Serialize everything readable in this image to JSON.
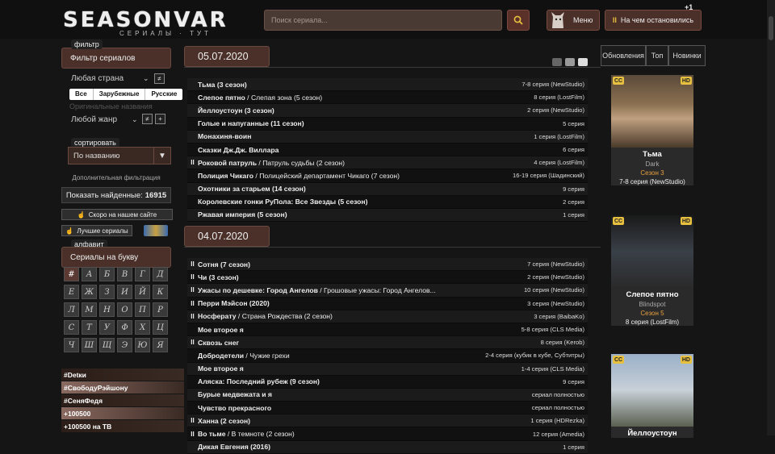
{
  "header": {
    "logo_text": "SEASONVAR",
    "logo_sub": "СЕРИАЛЫ · ТУТ",
    "search_placeholder": "Поиск сериала...",
    "menu_label": "Меню",
    "stop_label": "На чем остановились",
    "plus_badge": "+1"
  },
  "sidebar": {
    "filter_tag": "фильтр",
    "filter_title": "Фильтр сериалов",
    "country_select": "Любая страна",
    "country_buttons": [
      "Все",
      "Зарубежные",
      "Русские"
    ],
    "original_names": "Оригинальные названия",
    "genre_select": "Любой жанр",
    "not_label": "≠",
    "plus_label": "+",
    "sort_tag": "сортировать",
    "sort_value": "По названию",
    "extra_filter": "Дополнительная фильтрация",
    "found_label": "Показать найденные:",
    "found_count": "16915",
    "soon_label": "Скоро на нашем сайте",
    "best_label": "Лучшие сериалы",
    "alpha_tag": "алфавит",
    "alpha_title": "Сериалы на букву",
    "letters": [
      "#",
      "А",
      "Б",
      "В",
      "Г",
      "Д",
      "Е",
      "Ж",
      "З",
      "И",
      "Й",
      "К",
      "Л",
      "М",
      "Н",
      "О",
      "П",
      "Р",
      "С",
      "Т",
      "У",
      "Ф",
      "Х",
      "Ц",
      "Ч",
      "Ш",
      "Щ",
      "Э",
      "Ю",
      "Я"
    ],
    "hashtags": [
      {
        "text": "#Detки",
        "color": "#2b1d17"
      },
      {
        "text": "#СвободуРэйшону",
        "color": "#8a6a60"
      },
      {
        "text": "#СеняФедя",
        "color": "#2b1d17"
      },
      {
        "text": "+100500",
        "color": "#8a6a60"
      },
      {
        "text": "+100500 на ТВ",
        "color": "#2b1d17"
      }
    ]
  },
  "days": [
    {
      "date": "05.07.2020",
      "rows": [
        {
          "pause": false,
          "title": "Тьма (3 сезон)",
          "alt": "",
          "ep": "7-8 серия (NewStudio)"
        },
        {
          "pause": false,
          "title": "Слепое пятно",
          "alt": " / Слепая зона (5 сезон)",
          "ep": "8 серия (LostFilm)"
        },
        {
          "pause": false,
          "title": "Йеллоустоун (3 сезон)",
          "alt": "",
          "ep": "2 серия (NewStudio)"
        },
        {
          "pause": false,
          "title": "Голые и напуганные (11 сезон)",
          "alt": "",
          "ep": "5 серия"
        },
        {
          "pause": false,
          "title": "Монахиня-воин",
          "alt": "",
          "ep": "1 серия (LostFilm)"
        },
        {
          "pause": false,
          "title": "Сказки Дж.Дж. Виллара",
          "alt": "",
          "ep": "6 серия"
        },
        {
          "pause": true,
          "title": "Роковой патруль",
          "alt": " / Патруль судьбы (2 сезон)",
          "ep": "4 серия (LostFilm)"
        },
        {
          "pause": false,
          "title": "Полиция Чикаго",
          "alt": " / Полицейский департамент Чикаго (7 сезон)",
          "ep": "16-19 серия (Шадинский)"
        },
        {
          "pause": false,
          "title": "Охотники за старьем (14 сезон)",
          "alt": "",
          "ep": "9 серия"
        },
        {
          "pause": false,
          "title": "Королевские гонки РуПола: Все Звезды (5 сезон)",
          "alt": "",
          "ep": "2 серия"
        },
        {
          "pause": false,
          "title": "Ржавая империя (5 сезон)",
          "alt": "",
          "ep": "1 серия"
        }
      ]
    },
    {
      "date": "04.07.2020",
      "rows": [
        {
          "pause": true,
          "title": "Сотня (7 сезон)",
          "alt": "",
          "ep": "7 серия (NewStudio)"
        },
        {
          "pause": true,
          "title": "Чи (3 сезон)",
          "alt": "",
          "ep": "2 серия (NewStudio)"
        },
        {
          "pause": true,
          "title": "Ужасы по дешевке: Город Ангелов",
          "alt": " / Грошовые ужасы: Город Ангелов...",
          "ep": "10 серия (NewStudio)"
        },
        {
          "pause": true,
          "title": "Перри Мэйсон (2020)",
          "alt": "",
          "ep": "3 серия (NewStudio)"
        },
        {
          "pause": true,
          "title": "Носферату",
          "alt": " / Страна Рождества (2 сезон)",
          "ep": "3 серия (BaibaKo)"
        },
        {
          "pause": false,
          "title": "Мое второе я",
          "alt": "",
          "ep": "5-8 серия (CLS Media)"
        },
        {
          "pause": true,
          "title": "Сквозь снег",
          "alt": "",
          "ep": "8 серия (Kerob)"
        },
        {
          "pause": false,
          "title": "Добродетели",
          "alt": " / Чужие грехи",
          "ep": "2-4 серия (кубик в кубе, Субтитры)"
        },
        {
          "pause": false,
          "title": "Мое второе я",
          "alt": "",
          "ep": "1-4 серия (CLS Media)"
        },
        {
          "pause": false,
          "title": "Аляска: Последний рубеж (9 сезон)",
          "alt": "",
          "ep": "9 серия"
        },
        {
          "pause": false,
          "title": "Бурые медвежата и я",
          "alt": "",
          "ep": "сериал полностью"
        },
        {
          "pause": false,
          "title": "Чувство прекрасного",
          "alt": "",
          "ep": "сериал полностью"
        },
        {
          "pause": true,
          "title": "Ханна (2 сезон)",
          "alt": "",
          "ep": "1 серия (HDRezka)"
        },
        {
          "pause": true,
          "title": "Во тьме",
          "alt": " / В темноте (2 сезон)",
          "ep": "12 серия (Amedia)"
        },
        {
          "pause": false,
          "title": "Дикая Евгения (2016)",
          "alt": "",
          "ep": "1 серия"
        }
      ]
    }
  ],
  "right": {
    "tabs": [
      "Обновления",
      "Топ",
      "Новинки"
    ],
    "cards": [
      {
        "title": "Тьма",
        "orig": "Dark",
        "season": "Сезон 3",
        "ep": "7-8 серия (NewStudio)",
        "badge_cc": "CC",
        "badge_hd": "HD"
      },
      {
        "title": "Слепое пятно",
        "orig": "Blindspot",
        "season": "Сезон 5",
        "ep": "8 серия (LostFilm)",
        "badge_cc": "CC",
        "badge_hd": "HD"
      },
      {
        "title": "Йеллоустоун",
        "orig": "",
        "season": "",
        "ep": "",
        "badge_cc": "CC",
        "badge_hd": "HD"
      }
    ]
  },
  "colors": {
    "accent": "#4a3028",
    "pause": "#e8c040",
    "badge": "#e8c040"
  }
}
